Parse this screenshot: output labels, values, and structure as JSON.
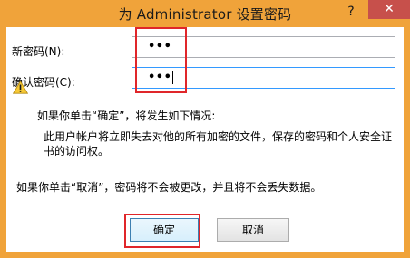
{
  "dialog": {
    "title": "为 Administrator 设置密码",
    "help_label": "?",
    "close_label": "✕"
  },
  "fields": {
    "new_password": {
      "label": "新密码(N):",
      "value": "•••"
    },
    "confirm_password": {
      "label": "确认密码(C):",
      "value": "•••"
    }
  },
  "warning": {
    "icon": "warning-icon",
    "heading": "如果你单击“确定”，将发生如下情况:",
    "body_line1": "此用户帐户将立即失去对他的所有加密的文件，保存的密码和个人安全证",
    "body_line2": "书的访问权。",
    "cancel_note": "如果你单击“取消”，密码将不会被更改，并且将不会丢失数据。"
  },
  "buttons": {
    "ok_label": "确定",
    "cancel_label": "取消"
  },
  "colors": {
    "frame": "#f0a33a",
    "close": "#c7504b",
    "highlight": "#e0262a"
  }
}
